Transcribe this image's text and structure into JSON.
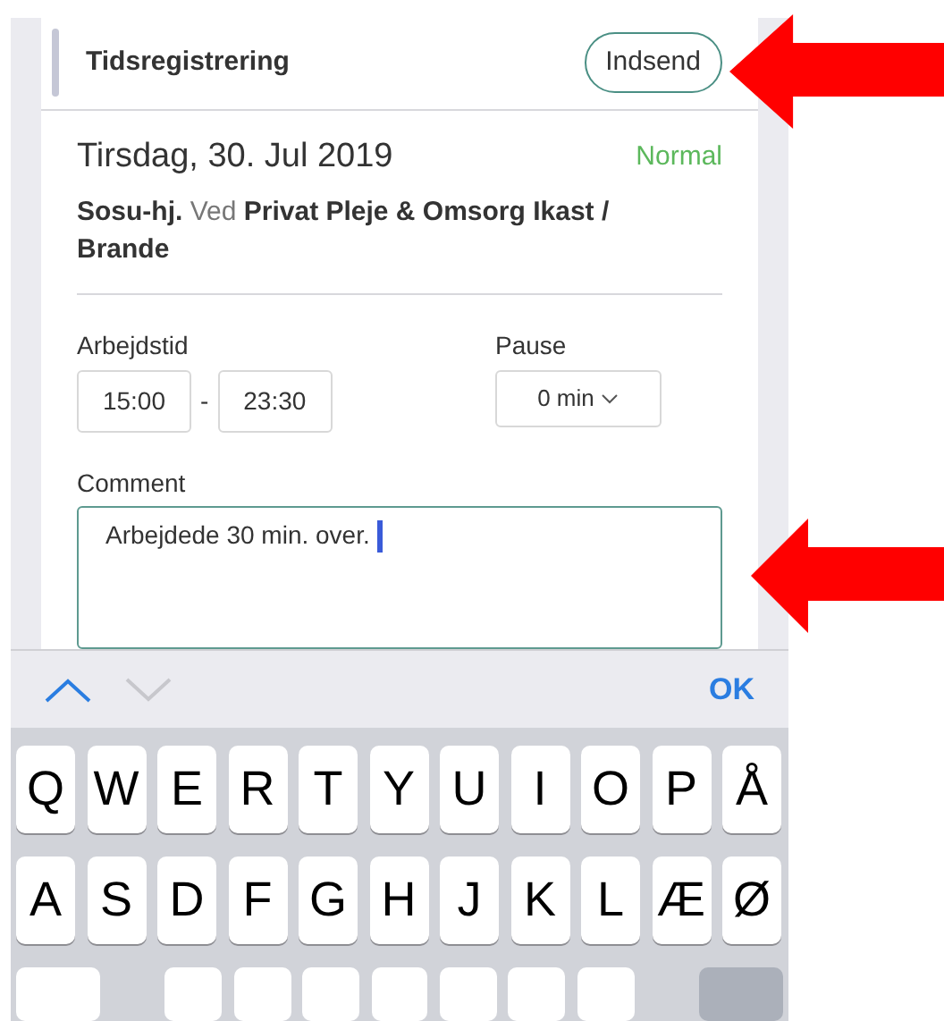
{
  "header": {
    "title": "Tidsregistrering",
    "submit_button": "Indsend"
  },
  "shift": {
    "date": "Tirsdag, 30. Jul 2019",
    "type": {
      "label": "Normal",
      "color": "#5cb85c"
    },
    "description": "**Sosu-hj.** Ved **Privat Pleje & Omsorg Ikast / Brande**"
  },
  "work_time": {
    "label": "Arbejdstid",
    "start": "15:00",
    "separator": "-",
    "end": "23:30"
  },
  "pause": {
    "label": "Pause",
    "value": "0 min"
  },
  "comment": {
    "label": "Comment",
    "value": "Arbejdede 30 min. over.",
    "focused": true
  },
  "keyboard_toolbar": {
    "previous_disabled": false,
    "next_disabled": true,
    "done": "OK"
  },
  "keyboard": {
    "rows": [
      {
        "keys": [
          {
            "kind": "letter",
            "label": "Q"
          },
          {
            "kind": "letter",
            "label": "W"
          },
          {
            "kind": "letter",
            "label": "E"
          },
          {
            "kind": "letter",
            "label": "R"
          },
          {
            "kind": "letter",
            "label": "T"
          },
          {
            "kind": "letter",
            "label": "Y"
          },
          {
            "kind": "letter",
            "label": "U"
          },
          {
            "kind": "letter",
            "label": "I"
          },
          {
            "kind": "letter",
            "label": "O"
          },
          {
            "kind": "letter",
            "label": "P"
          },
          {
            "kind": "letter",
            "label": "Å"
          }
        ]
      },
      {
        "keys": [
          {
            "kind": "letter",
            "label": "A"
          },
          {
            "kind": "letter",
            "label": "S"
          },
          {
            "kind": "letter",
            "label": "D"
          },
          {
            "kind": "letter",
            "label": "F"
          },
          {
            "kind": "letter",
            "label": "G"
          },
          {
            "kind": "letter",
            "label": "H"
          },
          {
            "kind": "letter",
            "label": "J"
          },
          {
            "kind": "letter",
            "label": "K"
          },
          {
            "kind": "letter",
            "label": "L"
          },
          {
            "kind": "letter",
            "label": "Æ"
          },
          {
            "kind": "letter",
            "label": "Ø"
          }
        ]
      },
      {
        "keys": [
          {
            "kind": "shift"
          },
          {
            "kind": "spacer"
          },
          {
            "kind": "letter"
          },
          {
            "kind": "letter"
          },
          {
            "kind": "letter"
          },
          {
            "kind": "letter"
          },
          {
            "kind": "letter"
          },
          {
            "kind": "letter"
          },
          {
            "kind": "letter"
          },
          {
            "kind": "spacer"
          },
          {
            "kind": "backspace"
          }
        ]
      }
    ]
  },
  "annotations": [
    {
      "kind": "arrow"
    },
    {
      "kind": "arrow"
    }
  ]
}
